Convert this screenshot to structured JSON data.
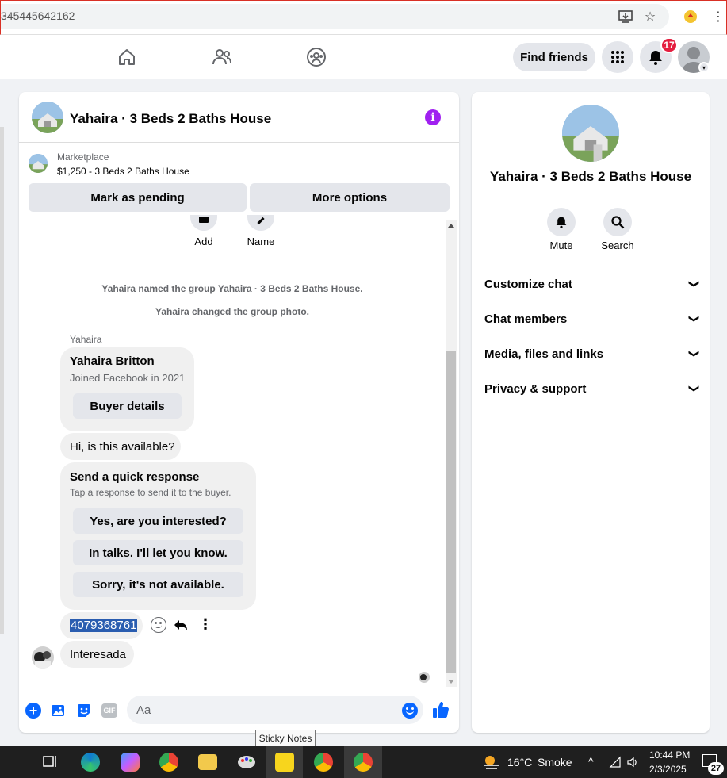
{
  "browser": {
    "url_fragment": "345445642162"
  },
  "header": {
    "find_friends": "Find friends",
    "notification_count": "17"
  },
  "chat": {
    "title": "Yahaira · 3 Beds 2 Baths House",
    "marketplace_label": "Marketplace",
    "listing": "$1,250 - 3 Beds 2 Baths House",
    "mark_pending": "Mark as pending",
    "more_options": "More options",
    "quick_actions": {
      "add": "Add",
      "name": "Name"
    },
    "system_messages": [
      "Yahaira named the group Yahaira · 3 Beds 2 Baths House.",
      "Yahaira changed the group photo."
    ],
    "sender_name": "Yahaira",
    "buyer_card": {
      "name": "Yahaira Britton",
      "joined": "Joined Facebook in 2021",
      "button": "Buyer details"
    },
    "message_1": "Hi, is this available?",
    "quick_response": {
      "title": "Send a quick response",
      "subtitle": "Tap a response to send it to the buyer.",
      "options": [
        "Yes, are you interested?",
        "In talks. I'll let you know.",
        "Sorry, it's not available."
      ]
    },
    "phone_message": "4079368761",
    "message_2": "Interesada",
    "composer_placeholder": "Aa"
  },
  "right_panel": {
    "title": "Yahaira · 3 Beds 2 Baths House",
    "mute": "Mute",
    "search": "Search",
    "sections": [
      "Customize chat",
      "Chat members",
      "Media, files and links",
      "Privacy & support"
    ]
  },
  "taskbar": {
    "tooltip": "Sticky Notes",
    "temperature": "16°C",
    "weather": "Smoke",
    "time": "10:44 PM",
    "date": "2/3/2025",
    "notification_count": "27"
  }
}
